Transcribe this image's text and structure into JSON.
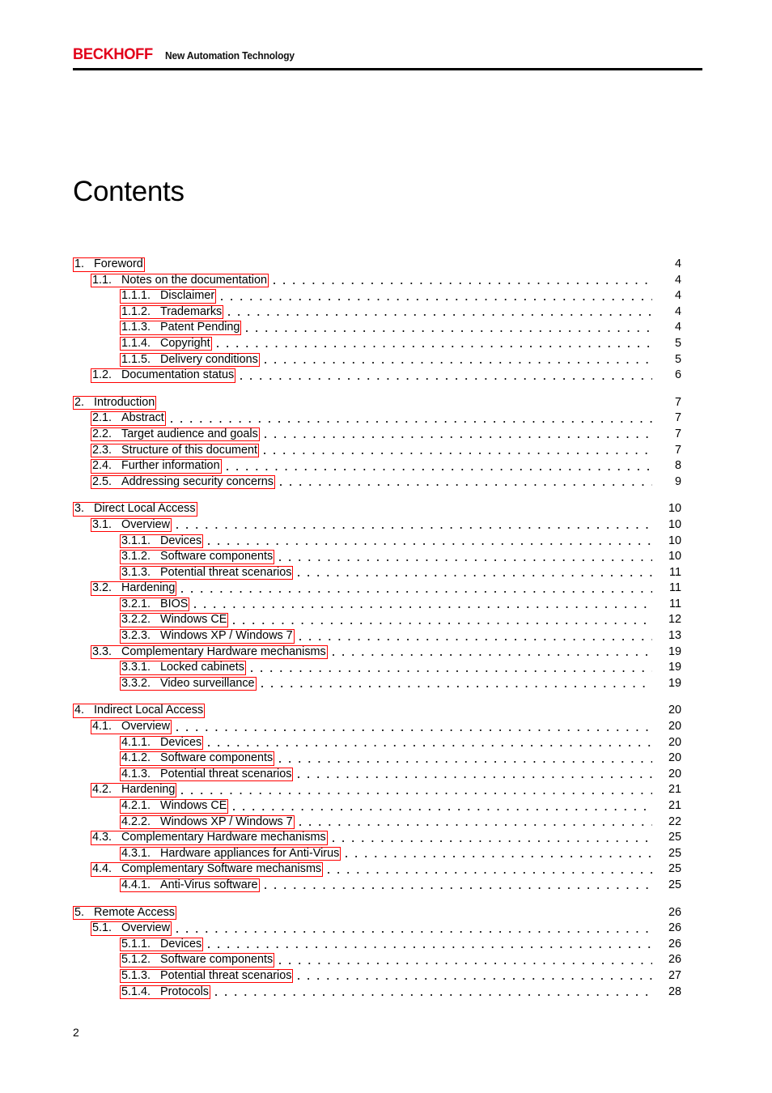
{
  "header": {
    "brand": "BECKHOFF",
    "tagline": "New Automation Technology"
  },
  "title": "Contents",
  "footer": {
    "page_number": "2"
  },
  "colors": {
    "brand_red": "#e2001a",
    "link_box_red": "#ff0000",
    "text": "#000000"
  },
  "toc": {
    "groups": [
      {
        "rows": [
          {
            "num": "1.",
            "text": "Foreword",
            "page": "4",
            "level": 1,
            "leader": false
          },
          {
            "num": "1.1.",
            "text": "Notes on the documentation",
            "page": "4",
            "level": 2,
            "leader": true
          },
          {
            "num": "1.1.1.",
            "text": "Disclaimer",
            "page": "4",
            "level": 3,
            "leader": true
          },
          {
            "num": "1.1.2.",
            "text": "Trademarks",
            "page": "4",
            "level": 3,
            "leader": true
          },
          {
            "num": "1.1.3.",
            "text": "Patent Pending",
            "page": "4",
            "level": 3,
            "leader": true
          },
          {
            "num": "1.1.4.",
            "text": "Copyright",
            "page": "5",
            "level": 3,
            "leader": true
          },
          {
            "num": "1.1.5.",
            "text": "Delivery conditions",
            "page": "5",
            "level": 3,
            "leader": true
          },
          {
            "num": "1.2.",
            "text": "Documentation status",
            "page": "6",
            "level": 2,
            "leader": true
          }
        ]
      },
      {
        "rows": [
          {
            "num": "2.",
            "text": "Introduction",
            "page": "7",
            "level": 1,
            "leader": false
          },
          {
            "num": "2.1.",
            "text": "Abstract",
            "page": "7",
            "level": 2,
            "leader": true
          },
          {
            "num": "2.2.",
            "text": "Target audience and goals",
            "page": "7",
            "level": 2,
            "leader": true
          },
          {
            "num": "2.3.",
            "text": "Structure of this document",
            "page": "7",
            "level": 2,
            "leader": true
          },
          {
            "num": "2.4.",
            "text": "Further information",
            "page": "8",
            "level": 2,
            "leader": true
          },
          {
            "num": "2.5.",
            "text": "Addressing security concerns",
            "page": "9",
            "level": 2,
            "leader": true
          }
        ]
      },
      {
        "rows": [
          {
            "num": "3.",
            "text": "Direct Local Access",
            "page": "10",
            "level": 1,
            "leader": false
          },
          {
            "num": "3.1.",
            "text": "Overview",
            "page": "10",
            "level": 2,
            "leader": true
          },
          {
            "num": "3.1.1.",
            "text": "Devices",
            "page": "10",
            "level": 3,
            "leader": true
          },
          {
            "num": "3.1.2.",
            "text": "Software components",
            "page": "10",
            "level": 3,
            "leader": true
          },
          {
            "num": "3.1.3.",
            "text": "Potential threat scenarios",
            "page": "11",
            "level": 3,
            "leader": true
          },
          {
            "num": "3.2.",
            "text": "Hardening",
            "page": "11",
            "level": 2,
            "leader": true
          },
          {
            "num": "3.2.1.",
            "text": "BIOS",
            "page": "11",
            "level": 3,
            "leader": true
          },
          {
            "num": "3.2.2.",
            "text": "Windows CE",
            "page": "12",
            "level": 3,
            "leader": true
          },
          {
            "num": "3.2.3.",
            "text": "Windows XP / Windows 7",
            "page": "13",
            "level": 3,
            "leader": true
          },
          {
            "num": "3.3.",
            "text": "Complementary Hardware mechanisms",
            "page": "19",
            "level": 2,
            "leader": true
          },
          {
            "num": "3.3.1.",
            "text": "Locked cabinets",
            "page": "19",
            "level": 3,
            "leader": true
          },
          {
            "num": "3.3.2.",
            "text": "Video surveillance",
            "page": "19",
            "level": 3,
            "leader": true
          }
        ]
      },
      {
        "rows": [
          {
            "num": "4.",
            "text": "Indirect Local Access",
            "page": "20",
            "level": 1,
            "leader": false
          },
          {
            "num": "4.1.",
            "text": "Overview",
            "page": "20",
            "level": 2,
            "leader": true
          },
          {
            "num": "4.1.1.",
            "text": "Devices",
            "page": "20",
            "level": 3,
            "leader": true
          },
          {
            "num": "4.1.2.",
            "text": "Software components",
            "page": "20",
            "level": 3,
            "leader": true
          },
          {
            "num": "4.1.3.",
            "text": "Potential threat scenarios",
            "page": "20",
            "level": 3,
            "leader": true
          },
          {
            "num": "4.2.",
            "text": "Hardening",
            "page": "21",
            "level": 2,
            "leader": true
          },
          {
            "num": "4.2.1.",
            "text": "Windows CE",
            "page": "21",
            "level": 3,
            "leader": true
          },
          {
            "num": "4.2.2.",
            "text": "Windows XP / Windows 7",
            "page": "22",
            "level": 3,
            "leader": true
          },
          {
            "num": "4.3.",
            "text": "Complementary Hardware mechanisms",
            "page": "25",
            "level": 2,
            "leader": true
          },
          {
            "num": "4.3.1.",
            "text": "Hardware appliances for Anti-Virus",
            "page": "25",
            "level": 3,
            "leader": true
          },
          {
            "num": "4.4.",
            "text": "Complementary Software mechanisms",
            "page": "25",
            "level": 2,
            "leader": true
          },
          {
            "num": "4.4.1.",
            "text": "Anti-Virus software",
            "page": "25",
            "level": 3,
            "leader": true
          }
        ]
      },
      {
        "rows": [
          {
            "num": "5.",
            "text": "Remote Access",
            "page": "26",
            "level": 1,
            "leader": false
          },
          {
            "num": "5.1.",
            "text": "Overview",
            "page": "26",
            "level": 2,
            "leader": true
          },
          {
            "num": "5.1.1.",
            "text": "Devices",
            "page": "26",
            "level": 3,
            "leader": true
          },
          {
            "num": "5.1.2.",
            "text": "Software components",
            "page": "26",
            "level": 3,
            "leader": true
          },
          {
            "num": "5.1.3.",
            "text": "Potential threat scenarios",
            "page": "27",
            "level": 3,
            "leader": true
          },
          {
            "num": "5.1.4.",
            "text": "Protocols",
            "page": "28",
            "level": 3,
            "leader": true
          }
        ]
      }
    ]
  }
}
